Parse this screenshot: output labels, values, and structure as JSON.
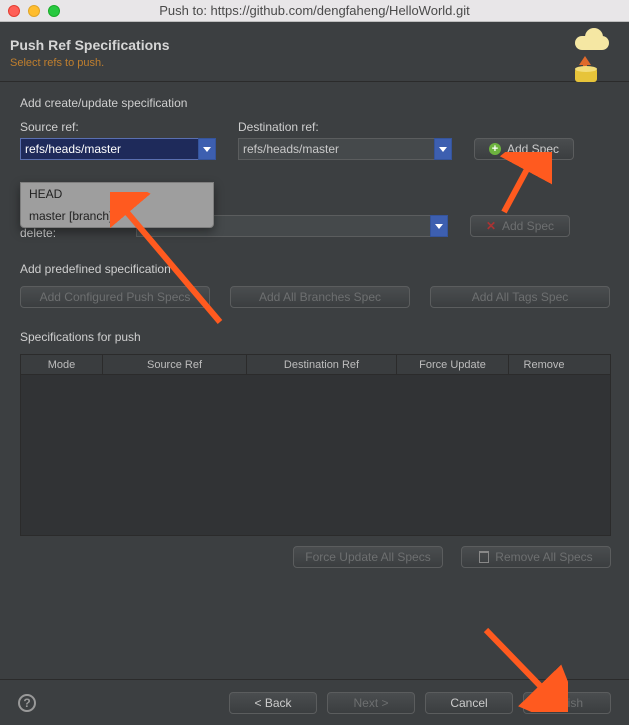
{
  "titlebar": {
    "title": "Push to: https://github.com/dengfaheng/HelloWorld.git"
  },
  "header": {
    "title": "Push Ref Specifications",
    "subtitle": "Select refs to push."
  },
  "create": {
    "section": "Add create/update specification",
    "source_label": "Source ref:",
    "source_value": "refs/heads/master",
    "dest_label": "Destination ref:",
    "dest_value": "refs/heads/master",
    "add_spec": "Add Spec",
    "dropdown": {
      "opt0": "HEAD",
      "opt1": "master [branch]"
    }
  },
  "delete": {
    "label": "Remote ref to delete:",
    "value": "",
    "add_spec": "Add Spec"
  },
  "predef": {
    "section": "Add predefined specification",
    "configured": "Add Configured Push Specs",
    "branches": "Add All Branches Spec",
    "tags": "Add All Tags Spec"
  },
  "spec": {
    "section": "Specifications for push",
    "cols": {
      "mode": "Mode",
      "src": "Source Ref",
      "dst": "Destination Ref",
      "force": "Force Update",
      "remove": "Remove"
    },
    "force_all": "Force Update All Specs",
    "remove_all": "Remove All Specs"
  },
  "footer": {
    "back": "< Back",
    "next": "Next >",
    "cancel": "Cancel",
    "finish": "Finish"
  }
}
